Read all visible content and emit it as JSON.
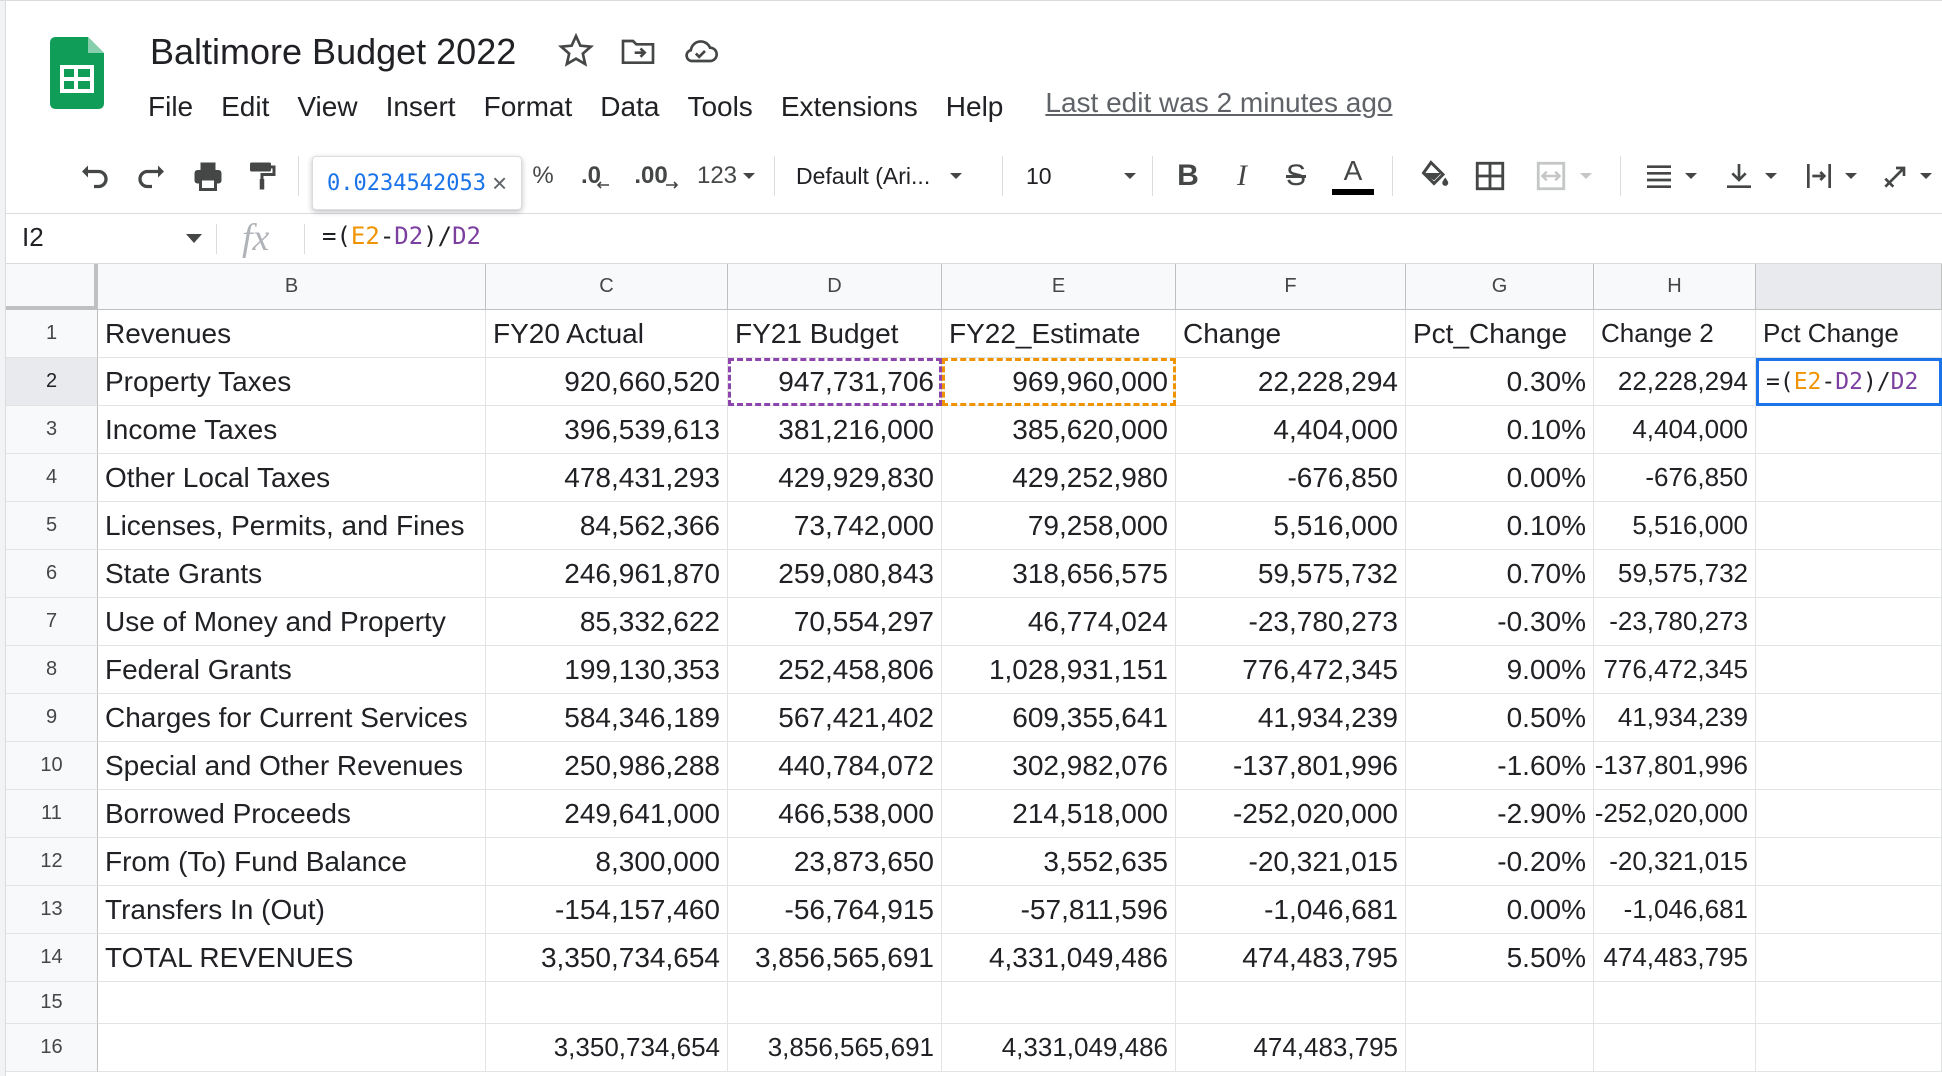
{
  "doc": {
    "title": "Baltimore Budget 2022",
    "last_edit": "Last edit was 2 minutes ago"
  },
  "menu": [
    "File",
    "Edit",
    "View",
    "Insert",
    "Format",
    "Data",
    "Tools",
    "Extensions",
    "Help"
  ],
  "toolbar": {
    "tooltip_value": "0.0234542053",
    "tooltip_close": "×",
    "percent": "%",
    "dec_decrease": ".0",
    "dec_increase": ".00",
    "more_formats": "123",
    "font": "Default (Ari...",
    "font_size": "10",
    "bold": "B",
    "italic": "I",
    "strike": "S",
    "text_color": "A"
  },
  "formula_bar": {
    "name_box": "I2",
    "fx": "fx",
    "formula": {
      "pre": "=(",
      "e": "E2",
      "minus": "-",
      "d": "D2",
      "mid": ")/",
      "d2": "D2"
    }
  },
  "colors": {
    "accent": "#1a73e8",
    "sheets_green": "#0f9d58",
    "ref_e": "#f09300",
    "ref_d": "#7b3fa0"
  },
  "columns": [
    "B",
    "C",
    "D",
    "E",
    "F",
    "G",
    "H",
    ""
  ],
  "row_numbers": [
    "1",
    "2",
    "3",
    "4",
    "5",
    "6",
    "7",
    "8",
    "9",
    "10",
    "11",
    "12",
    "13",
    "14",
    "15",
    "16"
  ],
  "rows": [
    [
      "Revenues",
      "FY20 Actual",
      "FY21 Budget",
      "FY22_Estimate",
      "Change",
      "Pct_Change",
      "Change 2",
      "Pct Change"
    ],
    [
      "Property Taxes",
      "920,660,520",
      "947,731,706",
      "969,960,000",
      "22,228,294",
      "0.30%",
      "22,228,294",
      ""
    ],
    [
      "Income Taxes",
      "396,539,613",
      "381,216,000",
      "385,620,000",
      "4,404,000",
      "0.10%",
      "4,404,000",
      ""
    ],
    [
      "Other Local Taxes",
      "478,431,293",
      "429,929,830",
      "429,252,980",
      "-676,850",
      "0.00%",
      "-676,850",
      ""
    ],
    [
      "Licenses, Permits, and Fines",
      "84,562,366",
      "73,742,000",
      "79,258,000",
      "5,516,000",
      "0.10%",
      "5,516,000",
      ""
    ],
    [
      "State Grants",
      "246,961,870",
      "259,080,843",
      "318,656,575",
      "59,575,732",
      "0.70%",
      "59,575,732",
      ""
    ],
    [
      "Use of Money and Property",
      "85,332,622",
      "70,554,297",
      "46,774,024",
      "-23,780,273",
      "-0.30%",
      "-23,780,273",
      ""
    ],
    [
      "Federal Grants",
      "199,130,353",
      "252,458,806",
      "1,028,931,151",
      "776,472,345",
      "9.00%",
      "776,472,345",
      ""
    ],
    [
      "Charges for Current Services",
      "584,346,189",
      "567,421,402",
      "609,355,641",
      "41,934,239",
      "0.50%",
      "41,934,239",
      ""
    ],
    [
      "Special and Other Revenues",
      "250,986,288",
      "440,784,072",
      "302,982,076",
      "-137,801,996",
      "-1.60%",
      "-137,801,996",
      ""
    ],
    [
      "Borrowed Proceeds",
      "249,641,000",
      "466,538,000",
      "214,518,000",
      "-252,020,000",
      "-2.90%",
      "-252,020,000",
      ""
    ],
    [
      "From (To) Fund Balance",
      "8,300,000",
      "23,873,650",
      "3,552,635",
      "-20,321,015",
      "-0.20%",
      "-20,321,015",
      ""
    ],
    [
      "Transfers In (Out)",
      "-154,157,460",
      "-56,764,915",
      "-57,811,596",
      "-1,046,681",
      "0.00%",
      "-1,046,681",
      ""
    ],
    [
      "TOTAL REVENUES",
      "3,350,734,654",
      "3,856,565,691",
      "4,331,049,486",
      "474,483,795",
      "5.50%",
      "474,483,795",
      ""
    ],
    [
      "",
      "",
      "",
      "",
      "",
      "",
      "",
      ""
    ],
    [
      "",
      "3,350,734,654",
      "3,856,565,691",
      "4,331,049,486",
      "474,483,795",
      "",
      "",
      ""
    ]
  ]
}
